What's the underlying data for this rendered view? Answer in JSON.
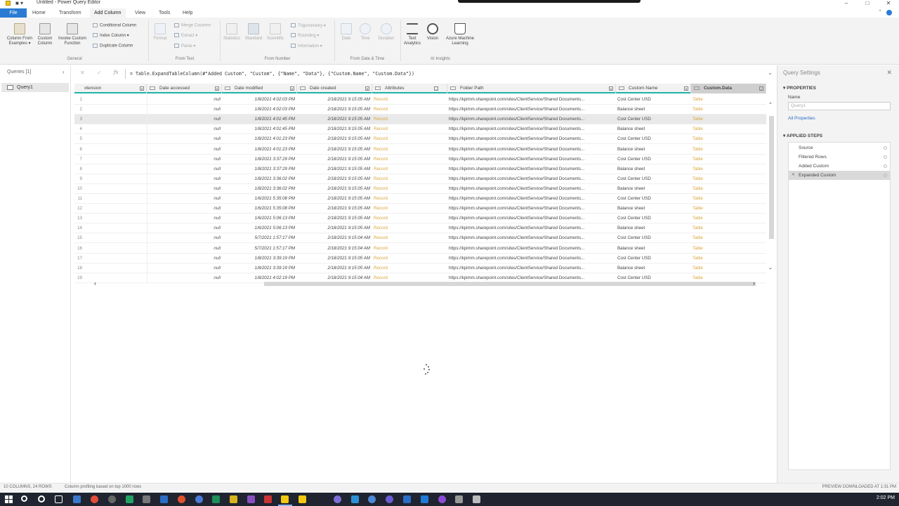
{
  "window": {
    "title": "Untitled - Power Query Editor",
    "qat": "■  ▾",
    "buttons": [
      "–",
      "□",
      "✕"
    ]
  },
  "tabs": [
    "File",
    "Home",
    "Transform",
    "Add Column",
    "View",
    "Tools",
    "Help"
  ],
  "active_tab": "Add Column",
  "ribbon": {
    "column_from_examples": "Column From\nExamples ▾",
    "custom_column": "Custom\nColumn",
    "invoke_custom_function": "Invoke Custom\nFunction",
    "conditional_column": "Conditional Column",
    "index_column": "Index Column ▾",
    "duplicate_column": "Duplicate Column",
    "general_label": "General",
    "format": "Format",
    "merge_columns": "Merge Columns",
    "extract": "Extract ▾",
    "parse": "Parse ▾",
    "from_text_label": "From Text",
    "statistics": "Statistics",
    "standard": "Standard",
    "scientific": "Scientific",
    "trigonometry": "Trigonometry ▾",
    "rounding": "Rounding ▾",
    "information": "Information ▾",
    "from_number_label": "From Number",
    "date": "Date",
    "time": "Time",
    "duration": "Duration",
    "from_date_time_label": "From Date & Time",
    "text_analytics": "Text\nAnalytics",
    "vision": "Vision",
    "azure_ml": "Azure Machine\nLearning",
    "ai_insights_label": "AI Insights"
  },
  "queries": {
    "header": "Queries [1]",
    "items": [
      "Query1"
    ]
  },
  "formula": {
    "fx": "fx",
    "text": "= Table.ExpandTableColumn(#\"Added Custom\", \"Custom\", {\"Name\", \"Data\"}, {\"Custom.Name\", \"Custom.Data\"})"
  },
  "grid": {
    "columns": [
      "xtension",
      "Date accessed",
      "Date modified",
      "Date created",
      "Attributes",
      "Folder Path",
      "Custom.Name",
      "Custom.Data"
    ],
    "rows": [
      {
        "n": "1",
        "accessed": "null",
        "modified": "1/8/2021 4:02:03 PM",
        "created": "2/18/2021 9:15:05 AM",
        "attr": "Record",
        "path": "https://kpimm.sharepoint.com/sites/ClientService/Shared Documents...",
        "name": "Cost Center USD",
        "data": "Table"
      },
      {
        "n": "2",
        "accessed": "null",
        "modified": "1/8/2021 4:02:03 PM",
        "created": "2/18/2021 9:15:05 AM",
        "attr": "Record",
        "path": "https://kpimm.sharepoint.com/sites/ClientService/Shared Documents...",
        "name": "Balance sheet",
        "data": "Table"
      },
      {
        "n": "3",
        "accessed": "null",
        "modified": "1/8/2021 4:01:45 PM",
        "created": "2/18/2021 9:15:05 AM",
        "attr": "Record",
        "path": "https://kpimm.sharepoint.com/sites/ClientService/Shared Documents...",
        "name": "Cost Center USD",
        "data": "Table"
      },
      {
        "n": "4",
        "accessed": "null",
        "modified": "1/8/2021 4:01:45 PM",
        "created": "2/18/2021 9:15:05 AM",
        "attr": "Record",
        "path": "https://kpimm.sharepoint.com/sites/ClientService/Shared Documents...",
        "name": "Balance sheet",
        "data": "Table"
      },
      {
        "n": "5",
        "accessed": "null",
        "modified": "1/8/2021 4:01:23 PM",
        "created": "2/18/2021 9:15:05 AM",
        "attr": "Record",
        "path": "https://kpimm.sharepoint.com/sites/ClientService/Shared Documents...",
        "name": "Cost Center USD",
        "data": "Table"
      },
      {
        "n": "6",
        "accessed": "null",
        "modified": "1/8/2021 4:01:23 PM",
        "created": "2/18/2021 9:15:05 AM",
        "attr": "Record",
        "path": "https://kpimm.sharepoint.com/sites/ClientService/Shared Documents...",
        "name": "Balance sheet",
        "data": "Table"
      },
      {
        "n": "7",
        "accessed": "null",
        "modified": "1/8/2021 3:37:29 PM",
        "created": "2/18/2021 9:15:05 AM",
        "attr": "Record",
        "path": "https://kpimm.sharepoint.com/sites/ClientService/Shared Documents...",
        "name": "Cost Center USD",
        "data": "Table"
      },
      {
        "n": "8",
        "accessed": "null",
        "modified": "1/8/2021 3:37:29 PM",
        "created": "2/18/2021 9:15:05 AM",
        "attr": "Record",
        "path": "https://kpimm.sharepoint.com/sites/ClientService/Shared Documents...",
        "name": "Balance sheet",
        "data": "Table"
      },
      {
        "n": "9",
        "accessed": "null",
        "modified": "1/8/2021 3:36:02 PM",
        "created": "2/18/2021 9:15:05 AM",
        "attr": "Record",
        "path": "https://kpimm.sharepoint.com/sites/ClientService/Shared Documents...",
        "name": "Cost Center USD",
        "data": "Table"
      },
      {
        "n": "10",
        "accessed": "null",
        "modified": "1/8/2021 3:36:02 PM",
        "created": "2/18/2021 9:15:05 AM",
        "attr": "Record",
        "path": "https://kpimm.sharepoint.com/sites/ClientService/Shared Documents...",
        "name": "Balance sheet",
        "data": "Table"
      },
      {
        "n": "11",
        "accessed": "null",
        "modified": "1/6/2021 5:35:08 PM",
        "created": "2/18/2021 9:15:05 AM",
        "attr": "Record",
        "path": "https://kpimm.sharepoint.com/sites/ClientService/Shared Documents...",
        "name": "Cost Center USD",
        "data": "Table"
      },
      {
        "n": "12",
        "accessed": "null",
        "modified": "1/6/2021 5:35:08 PM",
        "created": "2/18/2021 9:15:05 AM",
        "attr": "Record",
        "path": "https://kpimm.sharepoint.com/sites/ClientService/Shared Documents...",
        "name": "Balance sheet",
        "data": "Table"
      },
      {
        "n": "13",
        "accessed": "null",
        "modified": "1/6/2021 5:06:13 PM",
        "created": "2/18/2021 9:15:05 AM",
        "attr": "Record",
        "path": "https://kpimm.sharepoint.com/sites/ClientService/Shared Documents...",
        "name": "Cost Center USD",
        "data": "Table"
      },
      {
        "n": "14",
        "accessed": "null",
        "modified": "1/6/2021 5:06:13 PM",
        "created": "2/18/2021 9:15:05 AM",
        "attr": "Record",
        "path": "https://kpimm.sharepoint.com/sites/ClientService/Shared Documents...",
        "name": "Balance sheet",
        "data": "Table"
      },
      {
        "n": "15",
        "accessed": "null",
        "modified": "5/7/2021 1:57:17 PM",
        "created": "2/18/2021 9:15:04 AM",
        "attr": "Record",
        "path": "https://kpimm.sharepoint.com/sites/ClientService/Shared Documents...",
        "name": "Cost Center USD",
        "data": "Table"
      },
      {
        "n": "16",
        "accessed": "null",
        "modified": "5/7/2021 1:57:17 PM",
        "created": "2/18/2021 9:15:04 AM",
        "attr": "Record",
        "path": "https://kpimm.sharepoint.com/sites/ClientService/Shared Documents...",
        "name": "Balance sheet",
        "data": "Table"
      },
      {
        "n": "17",
        "accessed": "null",
        "modified": "1/8/2021 3:39:19 PM",
        "created": "2/18/2021 9:15:05 AM",
        "attr": "Record",
        "path": "https://kpimm.sharepoint.com/sites/ClientService/Shared Documents...",
        "name": "Cost Center USD",
        "data": "Table"
      },
      {
        "n": "18",
        "accessed": "null",
        "modified": "1/8/2021 3:39:19 PM",
        "created": "2/18/2021 9:15:05 AM",
        "attr": "Record",
        "path": "https://kpimm.sharepoint.com/sites/ClientService/Shared Documents...",
        "name": "Balance sheet",
        "data": "Table"
      },
      {
        "n": "19",
        "accessed": "null",
        "modified": "1/8/2021 4:02:19 PM",
        "created": "2/18/2021 9:15:04 AM",
        "attr": "Record",
        "path": "https://kpimm.sharepoint.com/sites/ClientService/Shared Documents...",
        "name": "Cost Center USD",
        "data": "Table"
      }
    ]
  },
  "query_settings": {
    "title": "Query Settings",
    "properties": "PROPERTIES",
    "name_label": "Name",
    "name_value": "Query1",
    "all_properties": "All Properties",
    "applied_steps": "APPLIED STEPS",
    "steps": [
      "Source",
      "Filtered Rows",
      "Added Custom",
      "Expanded Custom"
    ]
  },
  "status": {
    "left": "10 COLUMNS, 24 ROWS",
    "profiling": "Column profiling based on top 1000 rows",
    "right": "PREVIEW DOWNLOADED AT 1:31 PM"
  },
  "taskbar": {
    "clock": "2:02 PM"
  },
  "colors": {
    "accent": "#2b7bd3",
    "link": "#d9a53a",
    "header_border": "#1fb3a8"
  }
}
